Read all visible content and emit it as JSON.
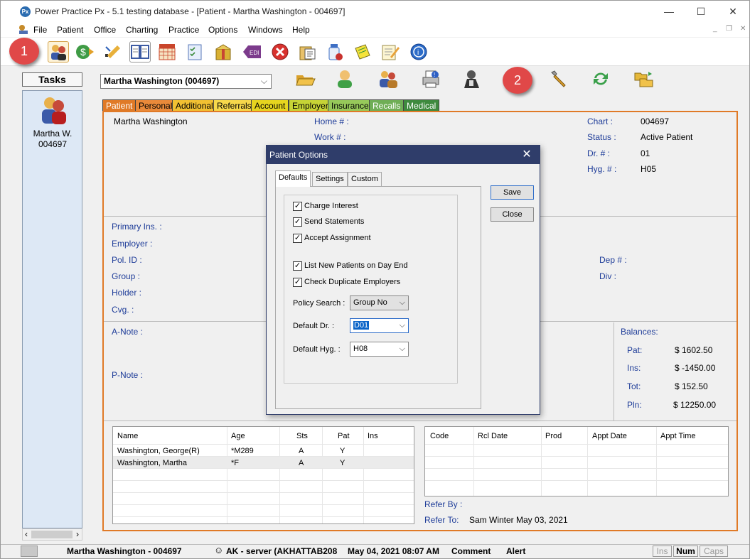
{
  "window": {
    "title": "Power Practice Px - 5.1 testing database - [Patient - Martha Washington - 004697]",
    "app_icon": "Px",
    "minimize": "—",
    "maximize": "☐",
    "close": "✕"
  },
  "menu": {
    "items": [
      "File",
      "Patient",
      "Office",
      "Charting",
      "Practice",
      "Options",
      "Windows",
      "Help"
    ]
  },
  "callouts": {
    "one": "1",
    "two": "2"
  },
  "tasks": {
    "header": "Tasks",
    "item_name": "Martha W.",
    "item_id": "004697",
    "scroll_left": "‹",
    "scroll_right": "›"
  },
  "patient_select": {
    "value": "Martha Washington (004697)"
  },
  "tabs": [
    {
      "label": "Patient",
      "color": "#e07a27"
    },
    {
      "label": "Personal",
      "color": "#ea8a3a"
    },
    {
      "label": "Additional",
      "color": "#f2c032"
    },
    {
      "label": "Referrals",
      "color": "#f7d84b"
    },
    {
      "label": "Account",
      "color": "#e6d51f"
    },
    {
      "label": "Employer",
      "color": "#c7d436"
    },
    {
      "label": "Insurance",
      "color": "#97c95a"
    },
    {
      "label": "Recalls",
      "color": "#6fae56"
    },
    {
      "label": "Medical",
      "color": "#3e8a3e"
    }
  ],
  "patient": {
    "name": "Martha Washington",
    "home_label": "Home # :",
    "work_label": "Work # :",
    "chart_label": "Chart :",
    "chart_value": "004697",
    "status_label": "Status :",
    "status_value": "Active Patient",
    "dr_label": "Dr. # :",
    "dr_value": "01",
    "hyg_label": "Hyg. # :",
    "hyg_value": "H05"
  },
  "insurance": {
    "primary": "Primary Ins. :",
    "employer": "Employer :",
    "pol_id": "Pol. ID :",
    "group": "Group :",
    "holder": "Holder :",
    "cvg": "Cvg. :",
    "dep": "Dep # :",
    "div": "Div :"
  },
  "notes": {
    "a_note": "A-Note :",
    "p_note": "P-Note :"
  },
  "balances": {
    "header": "Balances:",
    "rows": [
      {
        "label": "Pat:",
        "value": "$  1602.50"
      },
      {
        "label": "Ins:",
        "value": "$  -1450.00"
      },
      {
        "label": "Tot:",
        "value": "$   152.50"
      },
      {
        "label": "Pln:",
        "value": "$  12250.00"
      }
    ]
  },
  "family_grid": {
    "headers": [
      "Name",
      "Age",
      "Sts",
      "Pat",
      "Ins"
    ],
    "rows": [
      [
        "Washington, George(R)",
        "*M289",
        "A",
        "Y",
        ""
      ],
      [
        "Washington, Martha",
        "*F",
        "A",
        "Y",
        ""
      ]
    ]
  },
  "recall_grid": {
    "headers": [
      "Code",
      "Rcl Date",
      "Prod",
      "Appt Date",
      "Appt Time"
    ]
  },
  "referral": {
    "by_label": "Refer By :",
    "to_label": "Refer To:",
    "to_value": "Sam Winter May 03, 2021"
  },
  "status_bar": {
    "patient": "Martha Washington - 004697",
    "user": "AK - server (AKHATTAB208",
    "datetime": "May 04, 2021 08:07 AM",
    "comment": "Comment",
    "alert": "Alert",
    "ins": "Ins",
    "num": "Num",
    "caps": "Caps"
  },
  "dialog": {
    "title": "Patient Options",
    "close": "✕",
    "tabs": [
      "Defaults",
      "Settings",
      "Custom"
    ],
    "checkboxes": [
      {
        "label": "Charge Interest",
        "checked": true
      },
      {
        "label": "Send Statements",
        "checked": true
      },
      {
        "label": "Accept Assignment",
        "checked": true
      },
      {
        "label": "List New Patients on Day End",
        "checked": true
      },
      {
        "label": "Check Duplicate Employers",
        "checked": true
      }
    ],
    "check_mark": "✓",
    "policy_search_label": "Policy Search :",
    "policy_search_value": "Group No",
    "default_dr_label": "Default Dr. :",
    "default_dr_value": "D01",
    "default_hyg_label": "Default Hyg. :",
    "default_hyg_value": "H08",
    "save": "Save",
    "close_btn": "Close"
  }
}
